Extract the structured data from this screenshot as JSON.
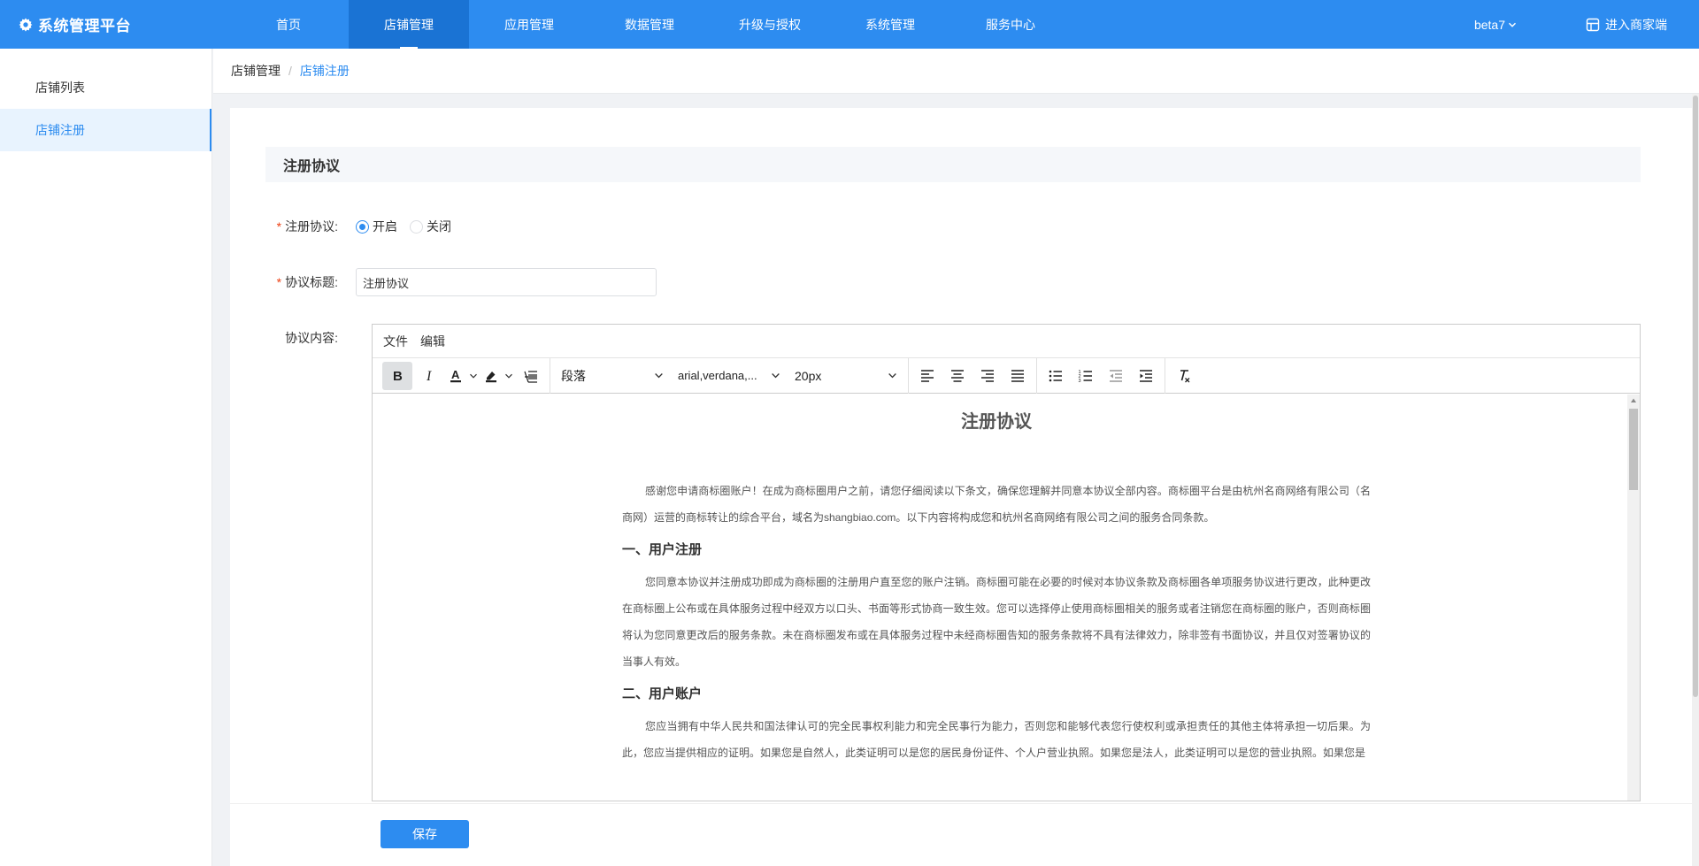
{
  "header": {
    "brand": "系统管理平台",
    "brand_icon": "gear-icon",
    "nav": [
      "首页",
      "店铺管理",
      "应用管理",
      "数据管理",
      "升级与授权",
      "系统管理",
      "服务中心"
    ],
    "active_nav": "店铺管理",
    "version": "beta7",
    "merchant_link": "进入商家端",
    "accent_color": "#2d8cf0"
  },
  "sidebar": {
    "items": [
      "店铺列表",
      "店铺注册"
    ],
    "active": "店铺注册"
  },
  "breadcrumb": {
    "items": [
      "店铺管理",
      "店铺注册"
    ],
    "separator": "/"
  },
  "form": {
    "section_title": "注册协议",
    "agreement_switch": {
      "label": "注册协议:",
      "required_mark": "*",
      "options": [
        "开启",
        "关闭"
      ],
      "selected": "开启"
    },
    "agreement_title": {
      "label": "协议标题:",
      "required_mark": "*",
      "value": "注册协议"
    },
    "agreement_content": {
      "label": "协议内容:"
    }
  },
  "editor": {
    "menus": [
      "文件",
      "编辑"
    ],
    "block_format": "段落",
    "font_family": "arial,verdana,...",
    "font_size": "20px",
    "content": {
      "title": "注册协议",
      "intro": "感谢您申请商标圈账户！在成为商标圈用户之前，请您仔细阅读以下条文，确保您理解并同意本协议全部内容。商标圈平台是由杭州名商网络有限公司（名商网）运营的商标转让的综合平台，域名为shangbiao.com。以下内容将构成您和杭州名商网络有限公司之间的服务合同条款。",
      "h1": "一、用户注册",
      "p1": "您同意本协议并注册成功即成为商标圈的注册用户直至您的账户注销。商标圈可能在必要的时候对本协议条款及商标圈各单项服务协议进行更改，此种更改在商标圈上公布或在具体服务过程中经双方以口头、书面等形式协商一致生效。您可以选择停止使用商标圈相关的服务或者注销您在商标圈的账户，否则商标圈将认为您同意更改后的服务条款。未在商标圈发布或在具体服务过程中未经商标圈告知的服务条款将不具有法律效力，除非签有书面协议，并且仅对签署协议的当事人有效。",
      "h2": "二、用户账户",
      "p2": "您应当拥有中华人民共和国法律认可的完全民事权利能力和完全民事行为能力，否则您和能够代表您行使权利或承担责任的其他主体将承担一切后果。为此，您应当提供相应的证明。如果您是自然人，此类证明可以是您的居民身份证件、个人户营业执照。如果您是法人，此类证明可以是您的营业执照。如果您是"
    }
  },
  "footer": {
    "save_label": "保存"
  }
}
